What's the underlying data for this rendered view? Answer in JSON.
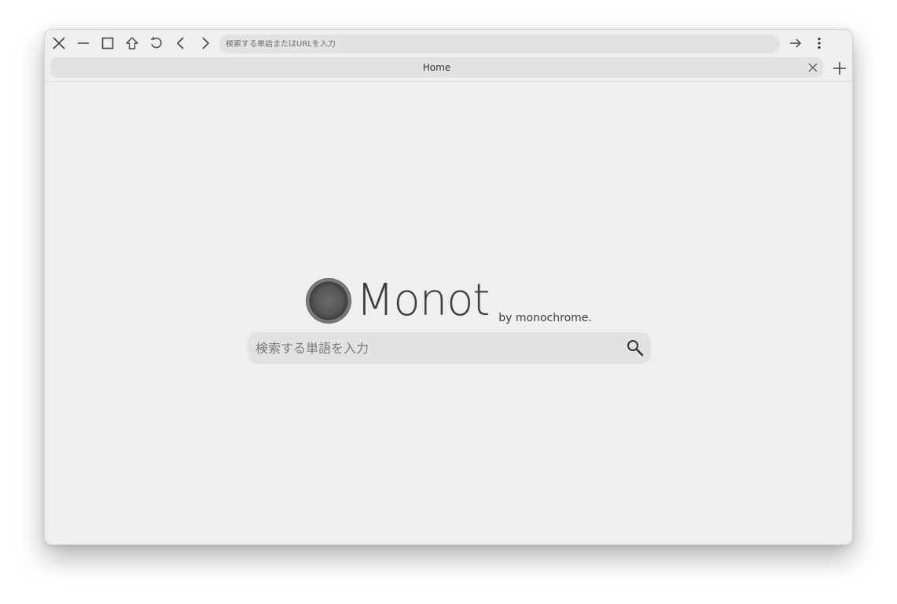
{
  "toolbar": {
    "icons": [
      "close-icon",
      "minimize-icon",
      "maximize-icon",
      "home-icon",
      "reload-icon",
      "back-icon",
      "forward-icon",
      "go-arrow-icon",
      "menu-kebab-icon"
    ],
    "address_placeholder": "検索する単語またはURLを入力"
  },
  "tabs": [
    {
      "title": "Home",
      "close_icon": "close-icon"
    }
  ],
  "new_tab_icon": "plus-icon",
  "home": {
    "brand_name": "Monot",
    "brand_by": "by monochrome.",
    "search_placeholder": "検索する単語を入力",
    "search_icon": "search-icon"
  },
  "colors": {
    "window_bg": "#efefef",
    "field_bg": "#e2e2e2",
    "text": "#3e3e3e"
  }
}
